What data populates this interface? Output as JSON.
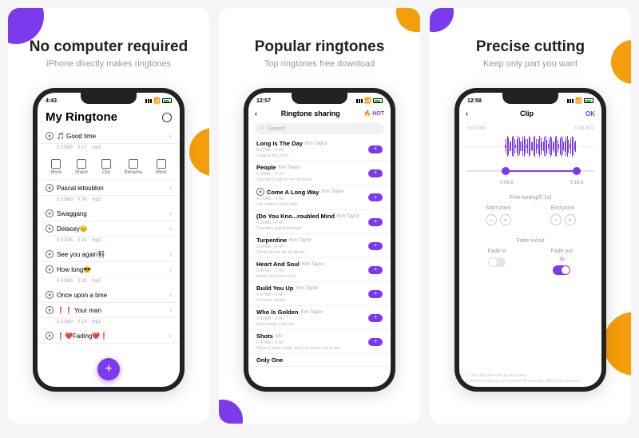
{
  "s1": {
    "title": "No computer required",
    "subtitle": "iPhone directly makes ringtones",
    "time": "4:43",
    "page_title": "My Ringtone",
    "tools": [
      {
        "label": "More"
      },
      {
        "label": "Share"
      },
      {
        "label": "Clip"
      },
      {
        "label": "Rename"
      },
      {
        "label": "More"
      }
    ],
    "items": [
      {
        "name": "🎵 Good time",
        "meta": [
          "0.25Mb",
          "0:17",
          "mp3"
        ]
      },
      {
        "name": "Pascal letoublon",
        "meta": [
          "0.53Mb",
          "0:34",
          "mp3"
        ]
      },
      {
        "name": "Swaggang",
        "meta": [
          "",
          "",
          ""
        ]
      },
      {
        "name": "Delacey😊",
        "meta": [
          "0.37Mb",
          "0:24",
          "mp3"
        ]
      },
      {
        "name": "See you again👫",
        "meta": [
          "",
          "",
          ""
        ]
      },
      {
        "name": "How long😎",
        "meta": [
          "0.51Mb",
          "0:33",
          "mp3"
        ]
      },
      {
        "name": "Once upon a time",
        "meta": [
          "",
          "",
          ""
        ]
      },
      {
        "name": "❗❗ Your man",
        "meta": [
          "0.21Mb",
          "0:14",
          "mp3"
        ]
      },
      {
        "name": "❗❤️Fading❤️❗",
        "meta": [
          "",
          "",
          ""
        ]
      }
    ]
  },
  "s2": {
    "title": "Popular ringtones",
    "subtitle": "Top ringtones free download",
    "time": "12:57",
    "nav": "Ringtone sharing",
    "hot": "🔥 HOT",
    "search": "Search",
    "items": [
      {
        "name": "Long Is The Day",
        "artist": "Kim Taylor",
        "meta": "0.47Mb · 0:40",
        "desc": "Long is the story"
      },
      {
        "name": "People",
        "artist": "Kim Taylor",
        "meta": "0.35Mb · 0:30",
        "desc": "You don't talk to me no more"
      },
      {
        "name": "Come A Long Way",
        "artist": "Kim Taylor",
        "meta": "0.25Mb · 0:48",
        "desc": "I've come a long way",
        "playing": true
      },
      {
        "name": "(Do You Kno...roubled Mind",
        "artist": "Kim Taylor",
        "meta": "0.30Mb · 0:40",
        "desc": "The time going through"
      },
      {
        "name": "Turpentine",
        "artist": "Kim Taylor",
        "meta": "0.24Mb · 0:40",
        "desc": "Ohhh da lee da da da da"
      },
      {
        "name": "Heart And Soul",
        "artist": "Kim Taylor",
        "meta": "0.47Mb · 0:40",
        "desc": "Heart and your soul"
      },
      {
        "name": "Build You Up",
        "artist": "Kim Taylor",
        "meta": "0.47Mb · 0:48",
        "desc": "I'll never doubt"
      },
      {
        "name": "Who Is Golden",
        "artist": "Kim Taylor",
        "meta": "0.40Mb · 0:40",
        "desc": "Hey lonely soul hey"
      },
      {
        "name": "Shots",
        "artist": "Mu",
        "meta": "0.47Mb · 0:40",
        "desc": "When I keep sayin' that I'm lookin' for a wa..."
      },
      {
        "name": "Only One",
        "artist": "",
        "meta": "",
        "desc": ""
      }
    ]
  },
  "s3": {
    "title": "Precise cutting",
    "subtitle": "Keep only part you want",
    "time": "12:58",
    "nav": "Clip",
    "ok": "OK",
    "tstart": "0:00.000",
    "tend": "0:33.301",
    "hstart": "0:09.8",
    "hend": "0:16.6",
    "fine": "Fine-tuning(0.1s)",
    "startp": "Start point",
    "endp": "End point",
    "fadeio": "Fade in/out",
    "fadein": "Fade in",
    "fadeout": "Fade out",
    "fadeoutv": "2s",
    "note1": "1. Drag the blue dots to trim audio",
    "note2": "2. iPhone ringtone can't exceed 40 seconds, SMS is 30 seconds"
  }
}
